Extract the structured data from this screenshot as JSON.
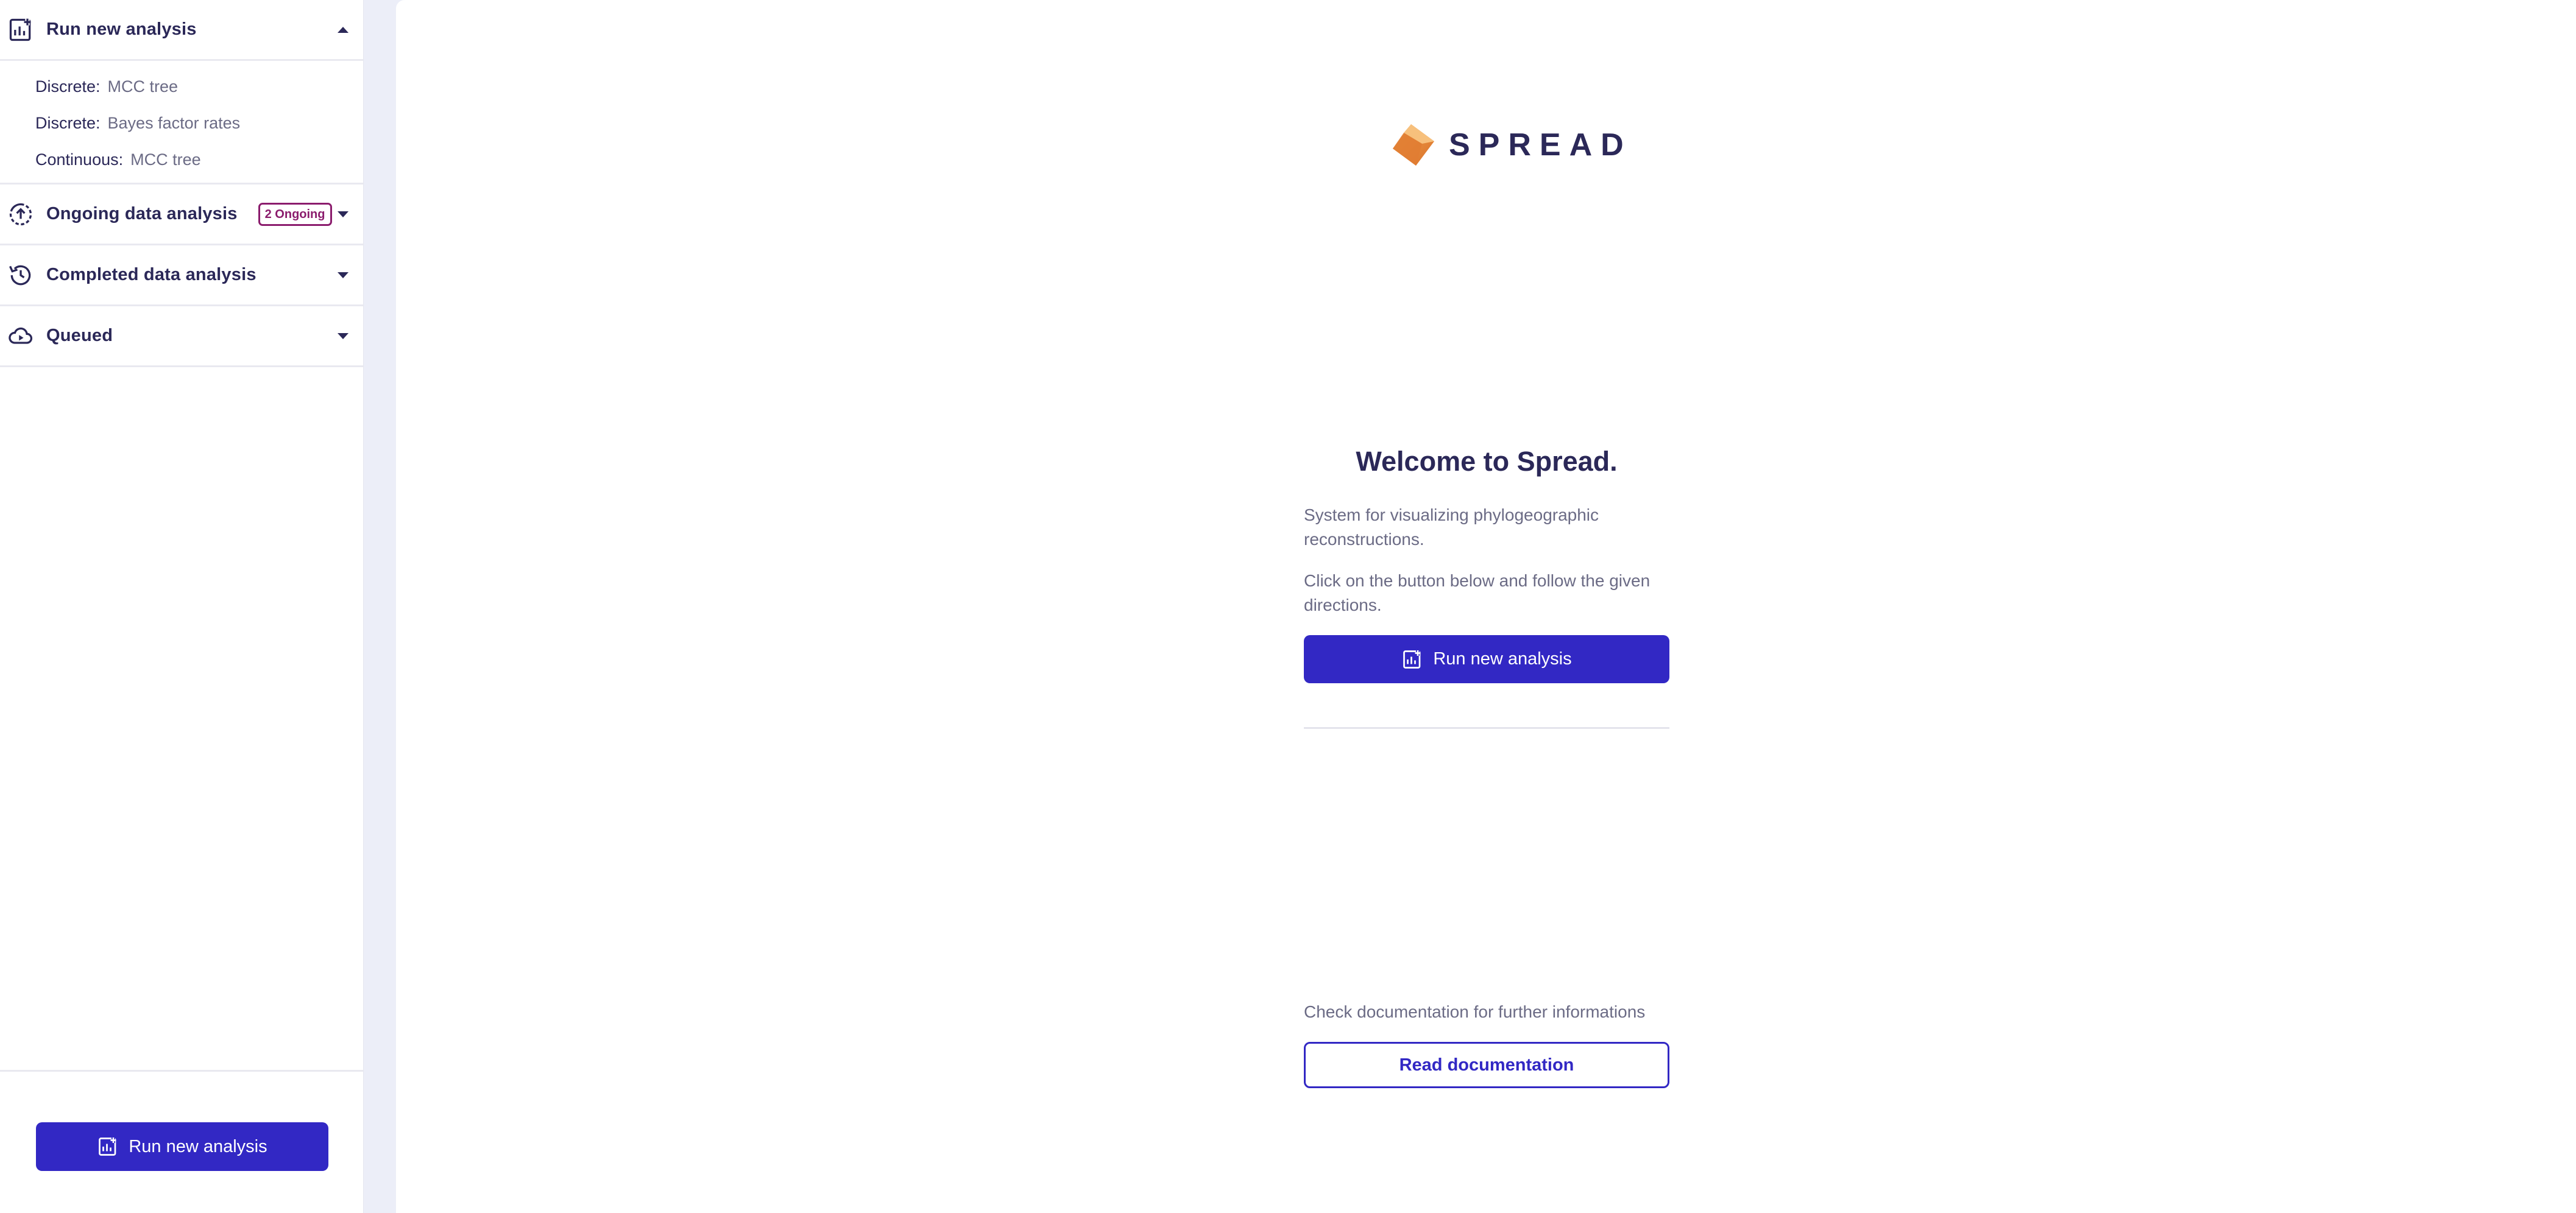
{
  "sidebar": {
    "sections": [
      {
        "title": "Run new analysis",
        "icon": "analysis-chart-icon",
        "expanded": true
      },
      {
        "title": "Ongoing data analysis",
        "icon": "ongoing-upload-icon",
        "expanded": false,
        "badge": "2 Ongoing"
      },
      {
        "title": "Completed data analysis",
        "icon": "history-icon",
        "expanded": false
      },
      {
        "title": "Queued",
        "icon": "cloud-queue-icon",
        "expanded": false
      }
    ],
    "run_items": [
      {
        "kind": "Discrete:",
        "label": "MCC tree"
      },
      {
        "kind": "Discrete:",
        "label": "Bayes factor rates"
      },
      {
        "kind": "Continuous:",
        "label": "MCC tree"
      }
    ],
    "bottom_button": "Run new analysis"
  },
  "main": {
    "logo_text": "SPREAD",
    "welcome_title": "Welcome to Spread.",
    "description": "System for visualizing phylogeographic reconstructions.",
    "instruction": "Click on the button below and follow the given directions.",
    "run_button": "Run new analysis",
    "doc_text": "Check documentation for further informations",
    "doc_button": "Read documentation"
  },
  "colors": {
    "primary": "#3228c4",
    "text_dark": "#2b2858",
    "text_muted": "#6b6b85",
    "badge": "#8b1c6d",
    "background": "#eceef8",
    "logo_orange": "#e8893a"
  }
}
